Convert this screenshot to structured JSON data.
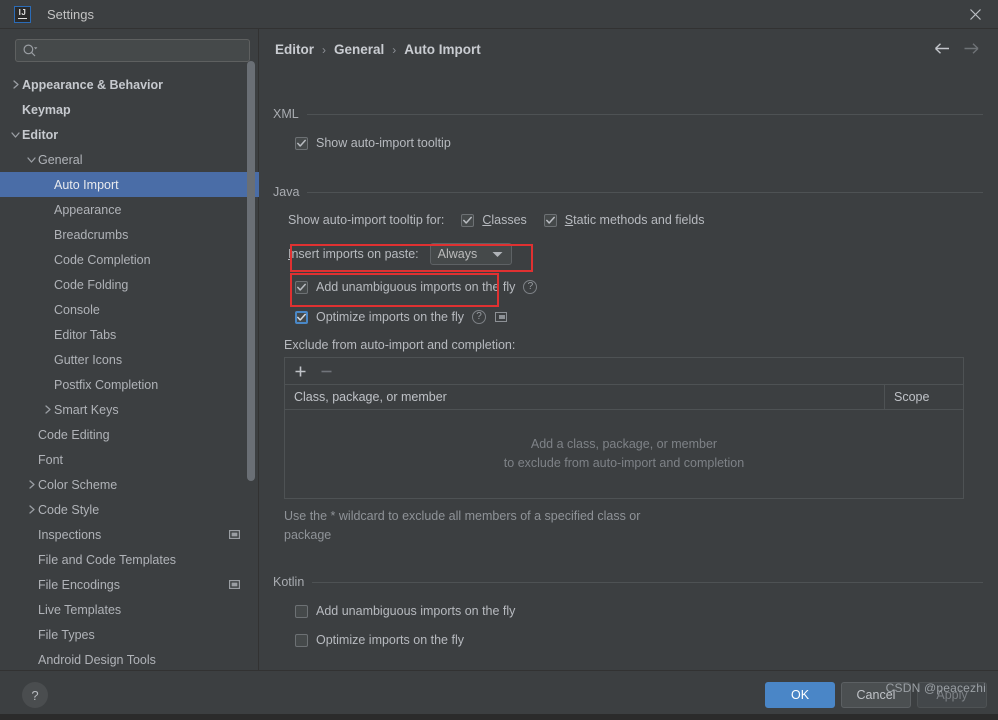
{
  "window": {
    "title": "Settings",
    "logo_text": "IJ",
    "close_icon": "close-icon"
  },
  "sidebar": {
    "search": {
      "value": "",
      "placeholder": ""
    },
    "items": [
      {
        "label": "Appearance & Behavior",
        "indent": 0,
        "arrow": "right",
        "bold": true,
        "selected": false,
        "modified": false
      },
      {
        "label": "Keymap",
        "indent": 0,
        "arrow": "none",
        "bold": true,
        "selected": false,
        "modified": false
      },
      {
        "label": "Editor",
        "indent": 0,
        "arrow": "down",
        "bold": true,
        "selected": false,
        "modified": false
      },
      {
        "label": "General",
        "indent": 1,
        "arrow": "down",
        "bold": false,
        "selected": false,
        "modified": false
      },
      {
        "label": "Auto Import",
        "indent": 2,
        "arrow": "none",
        "bold": false,
        "selected": true,
        "modified": false
      },
      {
        "label": "Appearance",
        "indent": 2,
        "arrow": "none",
        "bold": false,
        "selected": false,
        "modified": false
      },
      {
        "label": "Breadcrumbs",
        "indent": 2,
        "arrow": "none",
        "bold": false,
        "selected": false,
        "modified": false
      },
      {
        "label": "Code Completion",
        "indent": 2,
        "arrow": "none",
        "bold": false,
        "selected": false,
        "modified": false
      },
      {
        "label": "Code Folding",
        "indent": 2,
        "arrow": "none",
        "bold": false,
        "selected": false,
        "modified": false
      },
      {
        "label": "Console",
        "indent": 2,
        "arrow": "none",
        "bold": false,
        "selected": false,
        "modified": false
      },
      {
        "label": "Editor Tabs",
        "indent": 2,
        "arrow": "none",
        "bold": false,
        "selected": false,
        "modified": false
      },
      {
        "label": "Gutter Icons",
        "indent": 2,
        "arrow": "none",
        "bold": false,
        "selected": false,
        "modified": false
      },
      {
        "label": "Postfix Completion",
        "indent": 2,
        "arrow": "none",
        "bold": false,
        "selected": false,
        "modified": false
      },
      {
        "label": "Smart Keys",
        "indent": 2,
        "arrow": "right",
        "bold": false,
        "selected": false,
        "modified": false
      },
      {
        "label": "Code Editing",
        "indent": 1,
        "arrow": "none",
        "bold": false,
        "selected": false,
        "modified": false
      },
      {
        "label": "Font",
        "indent": 1,
        "arrow": "none",
        "bold": false,
        "selected": false,
        "modified": false
      },
      {
        "label": "Color Scheme",
        "indent": 1,
        "arrow": "right",
        "bold": false,
        "selected": false,
        "modified": false
      },
      {
        "label": "Code Style",
        "indent": 1,
        "arrow": "right",
        "bold": false,
        "selected": false,
        "modified": false
      },
      {
        "label": "Inspections",
        "indent": 1,
        "arrow": "none",
        "bold": false,
        "selected": false,
        "modified": true
      },
      {
        "label": "File and Code Templates",
        "indent": 1,
        "arrow": "none",
        "bold": false,
        "selected": false,
        "modified": false
      },
      {
        "label": "File Encodings",
        "indent": 1,
        "arrow": "none",
        "bold": false,
        "selected": false,
        "modified": true
      },
      {
        "label": "Live Templates",
        "indent": 1,
        "arrow": "none",
        "bold": false,
        "selected": false,
        "modified": false
      },
      {
        "label": "File Types",
        "indent": 1,
        "arrow": "none",
        "bold": false,
        "selected": false,
        "modified": false
      },
      {
        "label": "Android Design Tools",
        "indent": 1,
        "arrow": "none",
        "bold": false,
        "selected": false,
        "modified": false
      }
    ]
  },
  "breadcrumb": {
    "parts": [
      "Editor",
      "General",
      "Auto Import"
    ],
    "separator": "›"
  },
  "nav": {
    "back_icon": "arrow-left-icon",
    "forward_icon": "arrow-right-icon"
  },
  "sections": {
    "xml": {
      "title": "XML",
      "show_tooltip": {
        "label": "Show auto-import tooltip",
        "checked": true
      }
    },
    "java": {
      "title": "Java",
      "tooltip_for_label": "Show auto-import tooltip for:",
      "classes": {
        "label": "Classes",
        "mnemonic": "C",
        "checked": true
      },
      "static_methods": {
        "label": "Static methods and fields",
        "mnemonic": "S",
        "checked": true
      },
      "insert_imports_label": "Insert imports on paste:",
      "insert_imports_value": "Always",
      "add_unambiguous": {
        "label": "Add unambiguous imports on the fly",
        "checked": true,
        "focused": false
      },
      "optimize_imports": {
        "label": "Optimize imports on the fly",
        "checked": true,
        "focused": true
      },
      "exclude_label": "Exclude from auto-import and completion:",
      "table": {
        "add_icon": "plus-icon",
        "remove_icon": "minus-icon",
        "columns": [
          "Class, package, or member",
          "Scope"
        ],
        "rows": [],
        "empty_line1": "Add a class, package, or member",
        "empty_line2": "to exclude from auto-import and completion"
      },
      "wildcard_note": "Use the * wildcard to exclude all members of a specified class or package"
    },
    "kotlin": {
      "title": "Kotlin",
      "add_unambiguous": {
        "label": "Add unambiguous imports on the fly",
        "checked": false
      },
      "optimize_imports": {
        "label": "Optimize imports on the fly",
        "checked": false
      }
    }
  },
  "footer": {
    "help_label": "?",
    "ok_label": "OK",
    "cancel_label": "Cancel",
    "apply_label": "Apply"
  },
  "watermark": "CSDN @peacezhi",
  "colors": {
    "window_bg": "#3c3f41",
    "selection_blue": "#4a6da7",
    "accent_blue": "#4a86c7",
    "annotation_red": "#e03131",
    "text": "#b7babf"
  }
}
